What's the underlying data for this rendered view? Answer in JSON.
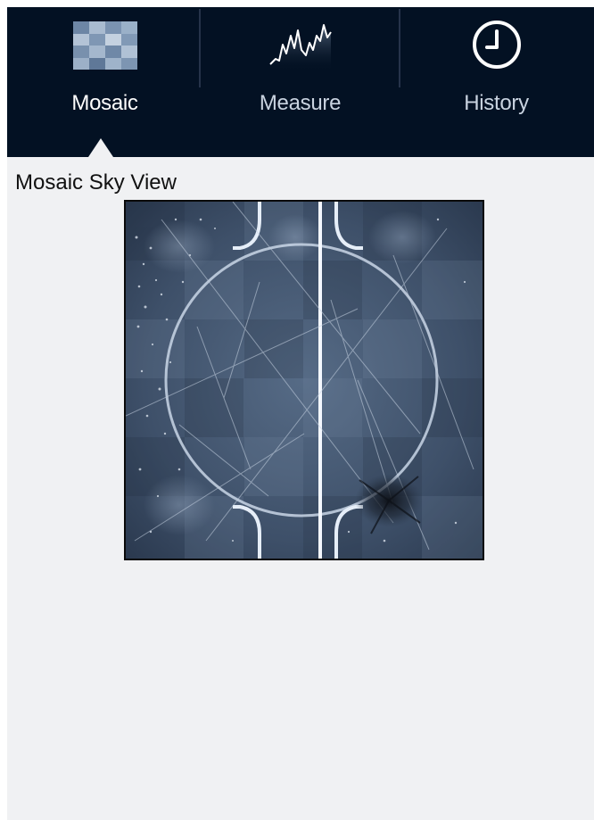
{
  "tabs": [
    {
      "id": "mosaic",
      "label": "Mosaic",
      "icon": "mosaic-grid-icon",
      "selected": true
    },
    {
      "id": "measure",
      "label": "Measure",
      "icon": "spectrum-graph-icon",
      "selected": false
    },
    {
      "id": "history",
      "label": "History",
      "icon": "clock-icon",
      "selected": false
    }
  ],
  "main": {
    "title": "Mosaic Sky View",
    "image": "mosaic-sky-view-image"
  },
  "colors": {
    "tabbar_bg": "#031123",
    "panel_bg": "#f0f1f3",
    "tab_selected_text": "#ffffff",
    "tab_text": "#c9d3e0"
  }
}
